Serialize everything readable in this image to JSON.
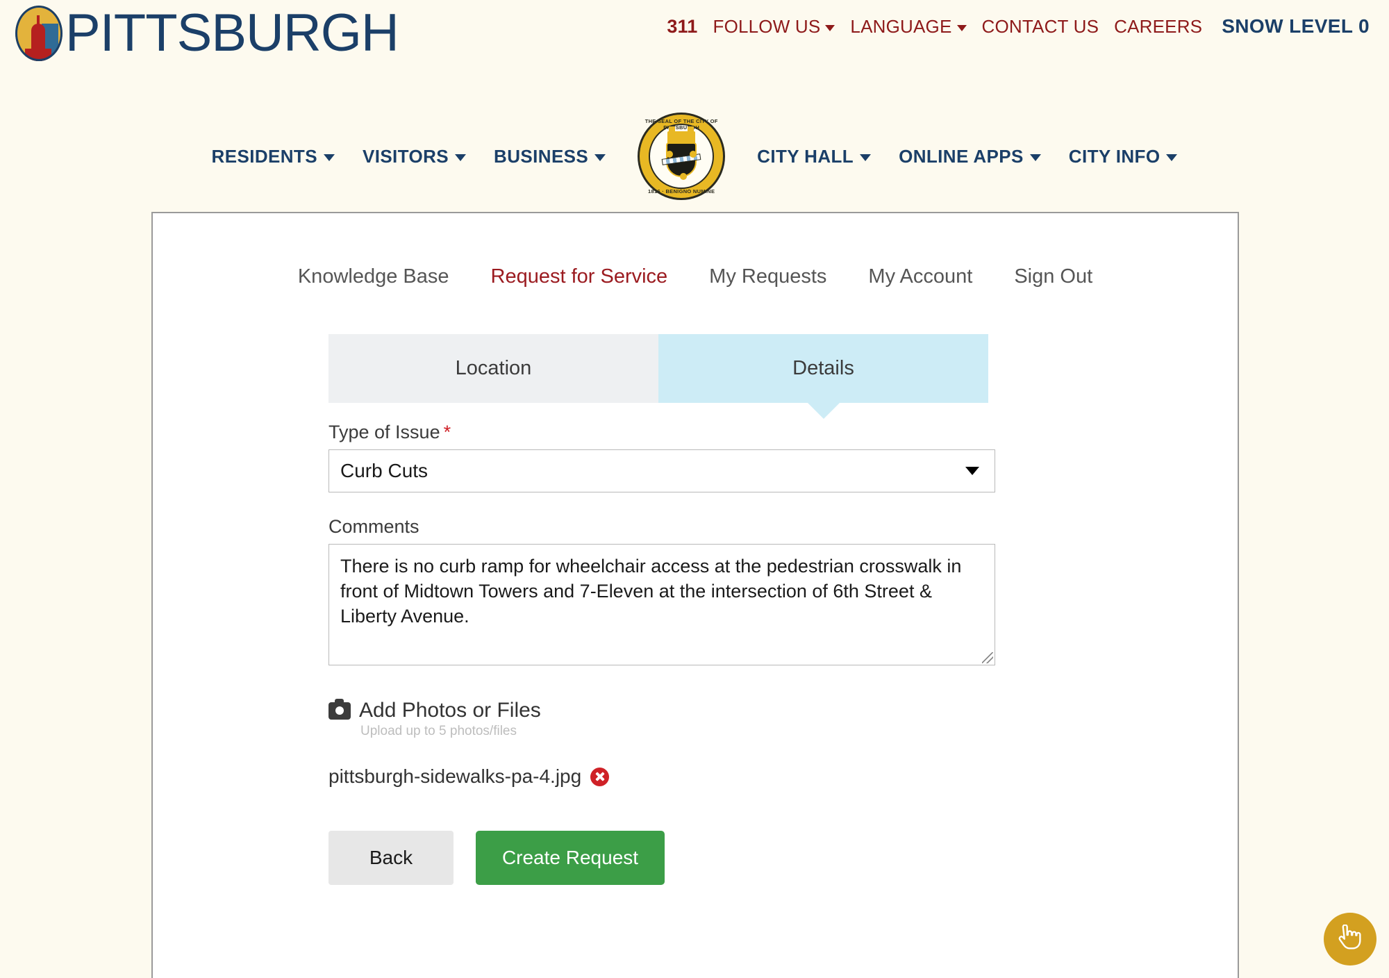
{
  "site": {
    "logo_text": "PITTSBURGH",
    "logo_icon": "pittsburgh-skyline-oval-logo"
  },
  "utility_nav": {
    "phone": "311",
    "items": [
      {
        "label": "FOLLOW US",
        "has_caret": true
      },
      {
        "label": "LANGUAGE",
        "has_caret": true
      },
      {
        "label": "CONTACT US",
        "has_caret": false
      },
      {
        "label": "CAREERS",
        "has_caret": false
      }
    ],
    "snow_level": "SNOW LEVEL 0",
    "accent_red": "#8e1a1a",
    "accent_navy": "#1b3f68"
  },
  "main_nav": {
    "left_items": [
      {
        "label": "RESIDENTS",
        "has_caret": true
      },
      {
        "label": "VISITORS",
        "has_caret": true
      },
      {
        "label": "BUSINESS",
        "has_caret": true
      }
    ],
    "right_items": [
      {
        "label": "CITY HALL",
        "has_caret": true
      },
      {
        "label": "ONLINE APPS",
        "has_caret": true
      },
      {
        "label": "CITY INFO",
        "has_caret": true
      }
    ],
    "seal": {
      "top_text": "THE SEAL OF THE CITY OF PITTSBURGH",
      "bottom_text": "1816  ·  BENIGNO NUMINE"
    }
  },
  "account_tabs": [
    {
      "label": "Knowledge Base",
      "active": false
    },
    {
      "label": "Request for Service",
      "active": true
    },
    {
      "label": "My Requests",
      "active": false
    },
    {
      "label": "My Account",
      "active": false
    },
    {
      "label": "Sign Out",
      "active": false
    }
  ],
  "step_tabs": [
    {
      "label": "Location",
      "active": false
    },
    {
      "label": "Details",
      "active": true
    }
  ],
  "form": {
    "type_of_issue": {
      "label": "Type of Issue",
      "required_marker": "*",
      "value": "Curb Cuts"
    },
    "comments": {
      "label": "Comments",
      "value": "There is no curb ramp for wheelchair access at the pedestrian crosswalk in front of Midtown Towers and 7-Eleven at the intersection of 6th Street & Liberty Avenue.",
      "placeholder": ""
    },
    "upload": {
      "title": "Add Photos or Files",
      "subtitle": "Upload up to 5 photos/files",
      "files": [
        {
          "name": "pittsburgh-sidewalks-pa-4.jpg"
        }
      ]
    },
    "buttons": {
      "back": "Back",
      "create": "Create Request",
      "create_color": "#3c9e47"
    }
  },
  "floating": {
    "cursor_button": "pointer-hand",
    "color": "#d3a020"
  }
}
